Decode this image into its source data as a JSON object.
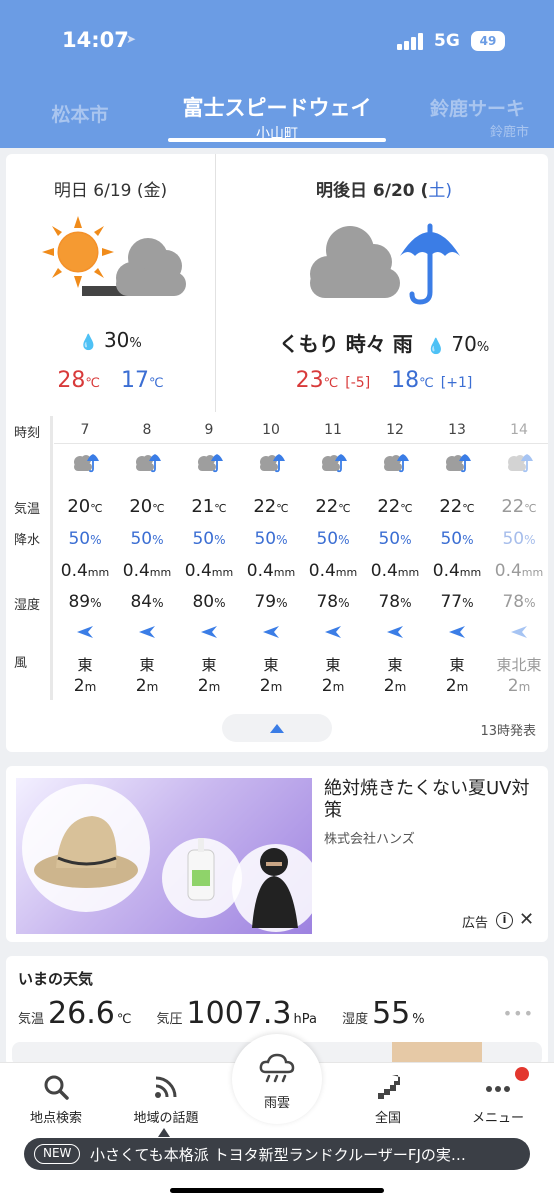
{
  "status": {
    "time": "14:07",
    "network": "5G",
    "battery": "49"
  },
  "tabs": {
    "prev": {
      "name": "松本市"
    },
    "current": {
      "name": "富士スピードウェイ",
      "sub": "小山町"
    },
    "next": {
      "name": "鈴鹿サーキ",
      "sub": "鈴鹿市"
    }
  },
  "days": [
    {
      "title": "明日 6/19 (金)",
      "condition": "",
      "rain_pct": "30",
      "rain_unit": "%",
      "hi": "28",
      "hi_diff": "",
      "lo": "17",
      "lo_diff": "",
      "icon": "sun-cloud-icon"
    },
    {
      "title_main": "明後日 6/20 (",
      "title_dow": "土",
      "title_end": ")",
      "condition": "くもり 時々 雨",
      "rain_pct": "70",
      "rain_unit": "%",
      "hi": "23",
      "hi_diff": "[-5]",
      "lo": "18",
      "lo_diff": "[+1]",
      "icon": "cloud-umbrella-icon"
    }
  ],
  "temp_unit": "℃",
  "hourly": {
    "labels": {
      "time": "時刻",
      "temp": "気温",
      "rain_prob": "降水",
      "humidity": "湿度",
      "wind": "風"
    },
    "hours": [
      {
        "hour": "7",
        "temp": "20",
        "rp": "50",
        "ra": "0.4",
        "hu": "89",
        "wd": "東",
        "ws": "2"
      },
      {
        "hour": "8",
        "temp": "20",
        "rp": "50",
        "ra": "0.4",
        "hu": "84",
        "wd": "東",
        "ws": "2"
      },
      {
        "hour": "9",
        "temp": "21",
        "rp": "50",
        "ra": "0.4",
        "hu": "80",
        "wd": "東",
        "ws": "2"
      },
      {
        "hour": "10",
        "temp": "22",
        "rp": "50",
        "ra": "0.4",
        "hu": "79",
        "wd": "東",
        "ws": "2"
      },
      {
        "hour": "11",
        "temp": "22",
        "rp": "50",
        "ra": "0.4",
        "hu": "78",
        "wd": "東",
        "ws": "2"
      },
      {
        "hour": "12",
        "temp": "22",
        "rp": "50",
        "ra": "0.4",
        "hu": "78",
        "wd": "東",
        "ws": "2"
      },
      {
        "hour": "13",
        "temp": "22",
        "rp": "50",
        "ra": "0.4",
        "hu": "77",
        "wd": "東",
        "ws": "2"
      },
      {
        "hour": "14",
        "temp": "22",
        "rp": "50",
        "ra": "0.4",
        "hu": "78",
        "wd": "東北東",
        "ws": "2"
      }
    ],
    "units": {
      "pct": "%",
      "mm": "mm",
      "m": "m",
      "c": "℃"
    },
    "issued": "13時発表"
  },
  "ad": {
    "title": "絶対焼きたくない夏UV対策",
    "company": "株式会社ハンズ",
    "label": "広告"
  },
  "now": {
    "title": "いまの天気",
    "temp_label": "気温",
    "temp": "26.6",
    "temp_unit": "℃",
    "pressure_label": "気圧",
    "pressure": "1007.3",
    "pressure_unit": "hPa",
    "humidity_label": "湿度",
    "humidity": "55",
    "humidity_unit": "%"
  },
  "nav": {
    "search": "地点検索",
    "topics": "地域の話題",
    "radar": "雨雲",
    "national": "全国",
    "menu": "メニュー"
  },
  "news": {
    "badge": "NEW",
    "text": "小さくても本格派 トヨタ新型ランドクルーザーFJの実…"
  },
  "colors": {
    "header": "#6b9ce4",
    "hi": "#d83a3a",
    "lo": "#3b6ed3",
    "rain": "#3b6ed3",
    "accent": "#3b7de6",
    "badge": "#e3372e"
  }
}
